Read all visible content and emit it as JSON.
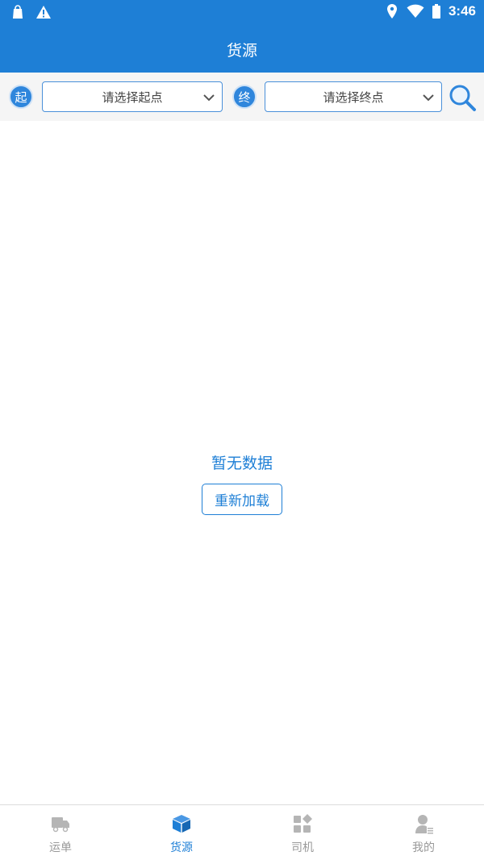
{
  "status_bar": {
    "time": "3:46"
  },
  "app_bar": {
    "title": "货源"
  },
  "filter": {
    "start_badge": "起",
    "start_placeholder": "请选择起点",
    "end_badge": "终",
    "end_placeholder": "请选择终点"
  },
  "empty_state": {
    "message": "暂无数据",
    "reload_label": "重新加载"
  },
  "bottom_nav": {
    "items": [
      {
        "label": "运单",
        "icon": "truck-icon"
      },
      {
        "label": "货源",
        "icon": "box-icon",
        "active": true
      },
      {
        "label": "司机",
        "icon": "grid-apps-icon"
      },
      {
        "label": "我的",
        "icon": "person-icon"
      }
    ]
  },
  "colors": {
    "primary": "#1e7fd6",
    "inactive": "#999999",
    "filter_bg": "#f5f5f5"
  }
}
